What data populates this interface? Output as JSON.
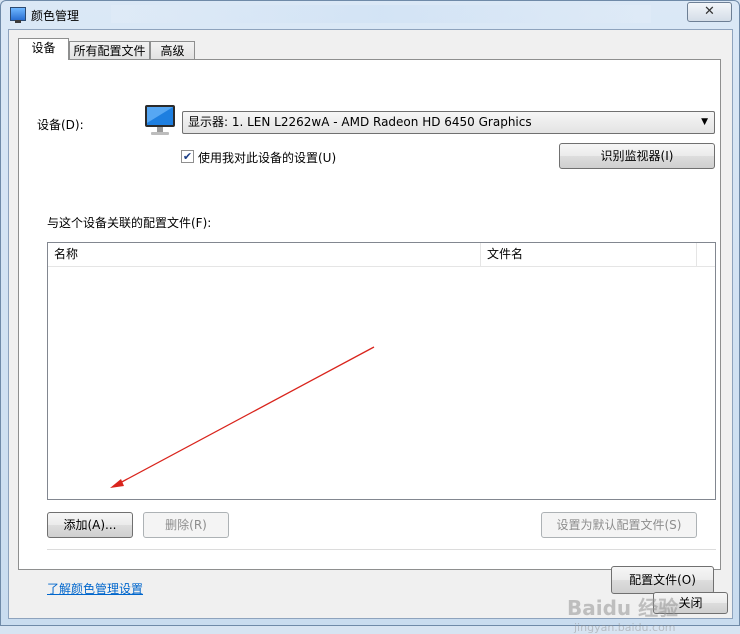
{
  "window": {
    "title": "颜色管理",
    "close_glyph": "✕"
  },
  "tabs": [
    {
      "label": "设备"
    },
    {
      "label": "所有配置文件"
    },
    {
      "label": "高级"
    }
  ],
  "device": {
    "label": "设备(D):",
    "selected": "显示器: 1. LEN L2262wA - AMD Radeon HD 6450 Graphics",
    "use_settings_label": "使用我对此设备的设置(U)",
    "use_settings_checked": true,
    "identify_button": "识别监视器(I)"
  },
  "profiles": {
    "label": "与这个设备关联的配置文件(F):",
    "columns": [
      "名称",
      "文件名"
    ],
    "rows": []
  },
  "buttons": {
    "add": "添加(A)...",
    "remove": "删除(R)",
    "set_default": "设置为默认配置文件(S)",
    "profiles": "配置文件(O)",
    "close": "关闭"
  },
  "link": "了解颜色管理设置",
  "watermark": {
    "main": "Baidu 经验",
    "sub": "jingyan.baidu.com"
  },
  "annotation_color": "#d9241c"
}
